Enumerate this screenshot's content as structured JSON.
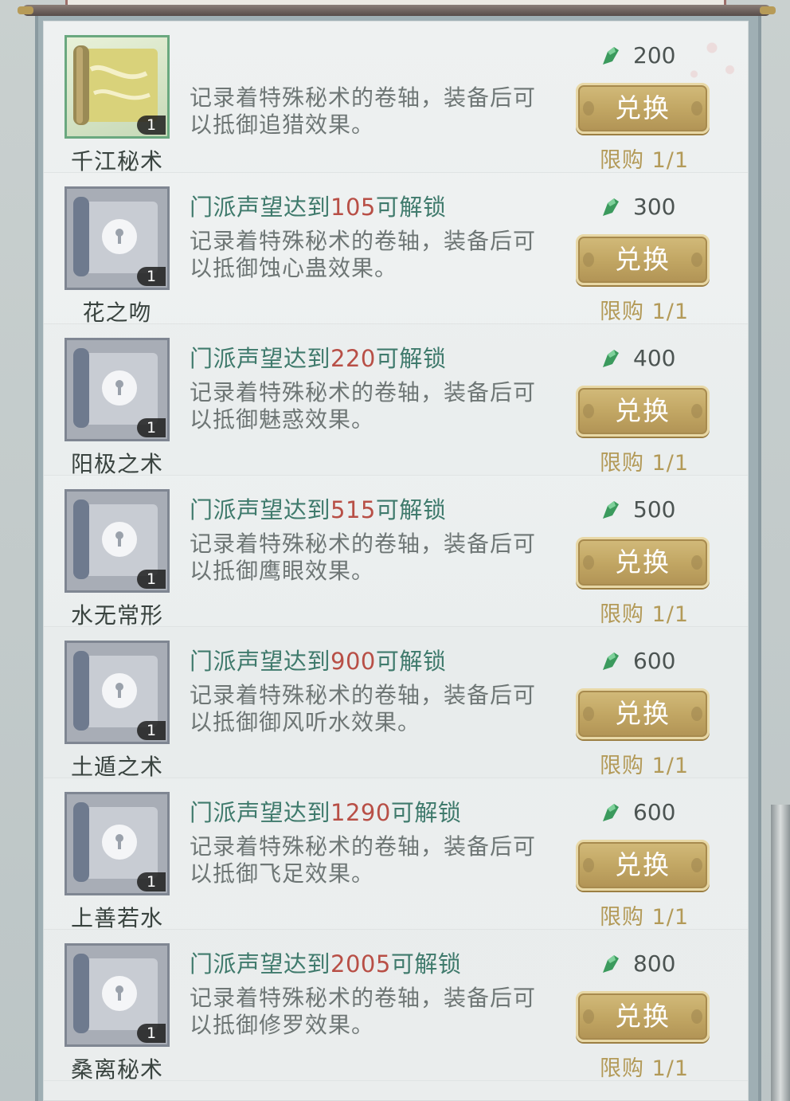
{
  "currency_icon": "jade-gem-icon",
  "colors": {
    "unlock_text": "#3f7a6c",
    "unlock_number": "#b84f46",
    "button_gold": "#c2a764",
    "limit_text": "#b39a58"
  },
  "items": [
    {
      "name": "千江秘术",
      "quantity": "1",
      "unlock_prefix": "",
      "unlock_number": "",
      "unlock_suffix": "",
      "desc_line1": "记录着特殊秘术的卷轴，装备后可",
      "desc_line2": "以抵御追猎效果。",
      "price": "200",
      "button": "兑换",
      "limit": "限购 1/1",
      "owned": true
    },
    {
      "name": "花之吻",
      "quantity": "1",
      "unlock_prefix": "门派声望达到",
      "unlock_number": "105",
      "unlock_suffix": "可解锁",
      "desc_line1": "记录着特殊秘术的卷轴，装备后可",
      "desc_line2": "以抵御蚀心蛊效果。",
      "price": "300",
      "button": "兑换",
      "limit": "限购 1/1",
      "owned": false
    },
    {
      "name": "阳极之术",
      "quantity": "1",
      "unlock_prefix": "门派声望达到",
      "unlock_number": "220",
      "unlock_suffix": "可解锁",
      "desc_line1": "记录着特殊秘术的卷轴，装备后可",
      "desc_line2": "以抵御魅惑效果。",
      "price": "400",
      "button": "兑换",
      "limit": "限购 1/1",
      "owned": false
    },
    {
      "name": "水无常形",
      "quantity": "1",
      "unlock_prefix": "门派声望达到",
      "unlock_number": "515",
      "unlock_suffix": "可解锁",
      "desc_line1": "记录着特殊秘术的卷轴，装备后可",
      "desc_line2": "以抵御鹰眼效果。",
      "price": "500",
      "button": "兑换",
      "limit": "限购 1/1",
      "owned": false
    },
    {
      "name": "土遁之术",
      "quantity": "1",
      "unlock_prefix": "门派声望达到",
      "unlock_number": "900",
      "unlock_suffix": "可解锁",
      "desc_line1": "记录着特殊秘术的卷轴，装备后可",
      "desc_line2": "以抵御御风听水效果。",
      "price": "600",
      "button": "兑换",
      "limit": "限购 1/1",
      "owned": false
    },
    {
      "name": "上善若水",
      "quantity": "1",
      "unlock_prefix": "门派声望达到",
      "unlock_number": "1290",
      "unlock_suffix": "可解锁",
      "desc_line1": "记录着特殊秘术的卷轴，装备后可",
      "desc_line2": "以抵御飞足效果。",
      "price": "600",
      "button": "兑换",
      "limit": "限购 1/1",
      "owned": false
    },
    {
      "name": "桑离秘术",
      "quantity": "1",
      "unlock_prefix": "门派声望达到",
      "unlock_number": "2005",
      "unlock_suffix": "可解锁",
      "desc_line1": "记录着特殊秘术的卷轴，装备后可",
      "desc_line2": "以抵御修罗效果。",
      "price": "800",
      "button": "兑换",
      "limit": "限购 1/1",
      "owned": false
    }
  ]
}
